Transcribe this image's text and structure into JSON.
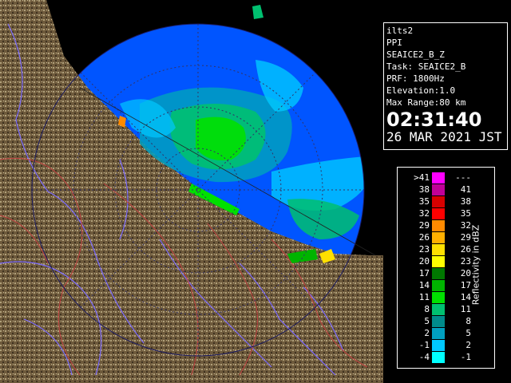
{
  "info": {
    "site": "ilts2",
    "product": "PPI",
    "variable": "SEAICE2_B_Z",
    "task": "Task: SEAICE2_B",
    "prf": "PRF: 1800Hz",
    "elevation": "Elevation:1.0",
    "max_range": "Max Range:80 km",
    "time": "02:31:40",
    "date": "26 MAR 2021 JST"
  },
  "legend": {
    "title": "Reflectivity in dBZ",
    "rows": [
      {
        "lo": ">41",
        "hi": "---",
        "color": "#ff00ff"
      },
      {
        "lo": "38",
        "hi": "41",
        "color": "#c00098"
      },
      {
        "lo": "35",
        "hi": "38",
        "color": "#d80000"
      },
      {
        "lo": "32",
        "hi": "35",
        "color": "#ff0000"
      },
      {
        "lo": "29",
        "hi": "32",
        "color": "#ff8a00"
      },
      {
        "lo": "26",
        "hi": "29",
        "color": "#ffb000"
      },
      {
        "lo": "23",
        "hi": "26",
        "color": "#ffe000"
      },
      {
        "lo": "20",
        "hi": "23",
        "color": "#ffff00"
      },
      {
        "lo": "17",
        "hi": "20",
        "color": "#007800"
      },
      {
        "lo": "14",
        "hi": "17",
        "color": "#00b400"
      },
      {
        "lo": "11",
        "hi": "14",
        "color": "#00e000"
      },
      {
        "lo": "8",
        "hi": "11",
        "color": "#00c070"
      },
      {
        "lo": "5",
        "hi": "8",
        "color": "#008c8c"
      },
      {
        "lo": "2",
        "hi": "5",
        "color": "#00a0c0"
      },
      {
        "lo": "-1",
        "hi": "2",
        "color": "#00c8ff"
      },
      {
        "lo": "-4",
        "hi": "-1",
        "color": "#00ffff"
      }
    ]
  },
  "colors": {
    "sea": "#0055ff",
    "land": "#6e5a3c",
    "outside": "#000000",
    "rivers": "#7b6bff",
    "boundaries": "#c04040"
  }
}
